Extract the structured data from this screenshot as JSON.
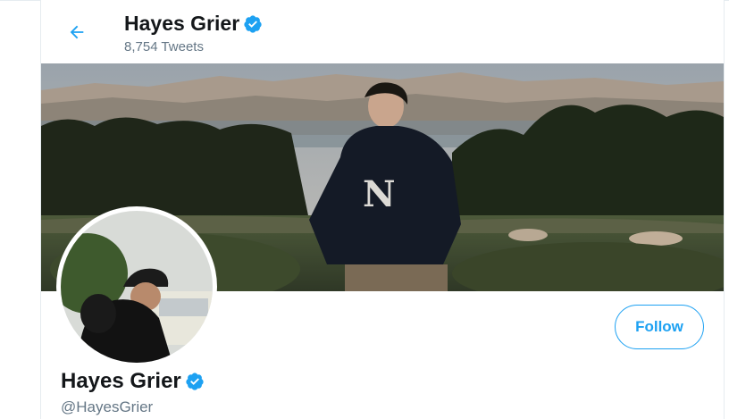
{
  "header": {
    "name": "Hayes Grier",
    "tweet_count": "8,754 Tweets",
    "back_icon": "arrow-left-icon"
  },
  "profile": {
    "name": "Hayes Grier",
    "handle": "@HayesGrier",
    "verified_icon": "verified-badge-icon",
    "follow_label": "Follow"
  },
  "colors": {
    "accent": "#1da1f2",
    "text_primary": "#14171a",
    "text_secondary": "#657786",
    "border": "#e6ecf0"
  }
}
